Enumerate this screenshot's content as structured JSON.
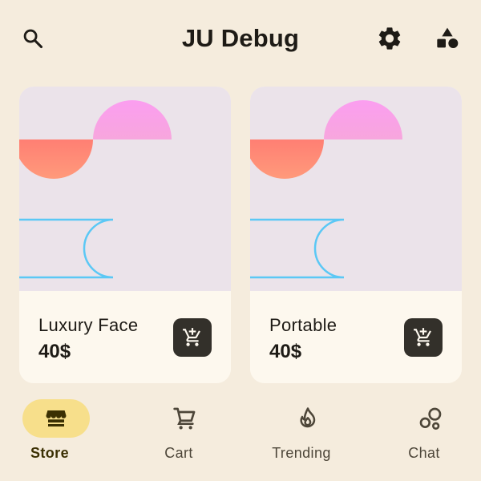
{
  "app": {
    "title": "JU Debug"
  },
  "header": {
    "search_icon": "search-icon",
    "settings_icon": "gear-icon",
    "shapes_icon": "shapes-icon"
  },
  "products": [
    {
      "name": "Luxury Face",
      "price": "40$",
      "add_icon": "add-shopping-cart-icon"
    },
    {
      "name": "Portable",
      "price": "40$",
      "add_icon": "add-shopping-cart-icon"
    }
  ],
  "nav": {
    "items": [
      {
        "label": "Store",
        "icon": "storefront-icon",
        "active": true
      },
      {
        "label": "Cart",
        "icon": "shopping-cart-icon",
        "active": false
      },
      {
        "label": "Trending",
        "icon": "flame-icon",
        "active": false
      },
      {
        "label": "Chat",
        "icon": "bubbles-icon",
        "active": false
      }
    ]
  },
  "colors": {
    "background": "#f5ecdd",
    "card_art": "#ebe3ea",
    "card_body": "#fdf8ee",
    "active_pill": "#f7df8b",
    "pink_shape": "#f9a4ec",
    "coral_shape": "#ff8a75",
    "outline_shape": "#5bc8f5",
    "button_dark": "#33302a"
  }
}
